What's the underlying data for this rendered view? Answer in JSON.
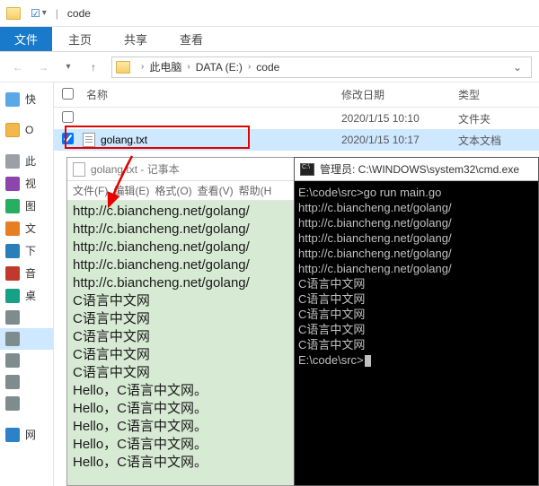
{
  "titlebar": {
    "title": "code"
  },
  "ribbon": {
    "file": "文件",
    "tabs": [
      "主页",
      "共享",
      "查看"
    ]
  },
  "breadcrumb": {
    "segments": [
      "此电脑",
      "DATA (E:)",
      "code"
    ]
  },
  "columns": {
    "name": "名称",
    "date": "修改日期",
    "type": "类型"
  },
  "files": [
    {
      "name": "",
      "date": "2020/1/15 10:10",
      "type": "文件夹",
      "checked": false
    },
    {
      "name": "golang.txt",
      "date": "2020/1/15 10:17",
      "type": "文本文档",
      "checked": true
    }
  ],
  "sidebar": {
    "items": [
      {
        "label": "快"
      },
      {
        "label": "O"
      },
      {
        "label": "此"
      },
      {
        "label": "视"
      },
      {
        "label": "图"
      },
      {
        "label": "文"
      },
      {
        "label": "下"
      },
      {
        "label": "音"
      },
      {
        "label": "桌"
      },
      {
        "label": ""
      },
      {
        "label": ""
      },
      {
        "label": ""
      },
      {
        "label": ""
      },
      {
        "label": ""
      },
      {
        "label": "网"
      }
    ]
  },
  "notepad": {
    "title": "golang.txt - 记事本",
    "menu": [
      "文件(F)",
      "编辑(E)",
      "格式(O)",
      "查看(V)",
      "帮助(H"
    ],
    "lines": [
      "http://c.biancheng.net/golang/",
      "http://c.biancheng.net/golang/",
      "http://c.biancheng.net/golang/",
      "http://c.biancheng.net/golang/",
      "http://c.biancheng.net/golang/",
      "C语言中文网",
      "C语言中文网",
      "C语言中文网",
      "C语言中文网",
      "C语言中文网",
      "Hello，C语言中文网。",
      "Hello，C语言中文网。",
      "Hello，C语言中文网。",
      "Hello，C语言中文网。",
      "Hello，C语言中文网。"
    ]
  },
  "cmd": {
    "title": "管理员: C:\\WINDOWS\\system32\\cmd.exe",
    "lines": [
      "E:\\code\\src>go run main.go",
      "http://c.biancheng.net/golang/",
      "http://c.biancheng.net/golang/",
      "http://c.biancheng.net/golang/",
      "http://c.biancheng.net/golang/",
      "http://c.biancheng.net/golang/",
      "C语言中文网",
      "C语言中文网",
      "C语言中文网",
      "C语言中文网",
      "C语言中文网",
      "",
      "E:\\code\\src>"
    ]
  }
}
